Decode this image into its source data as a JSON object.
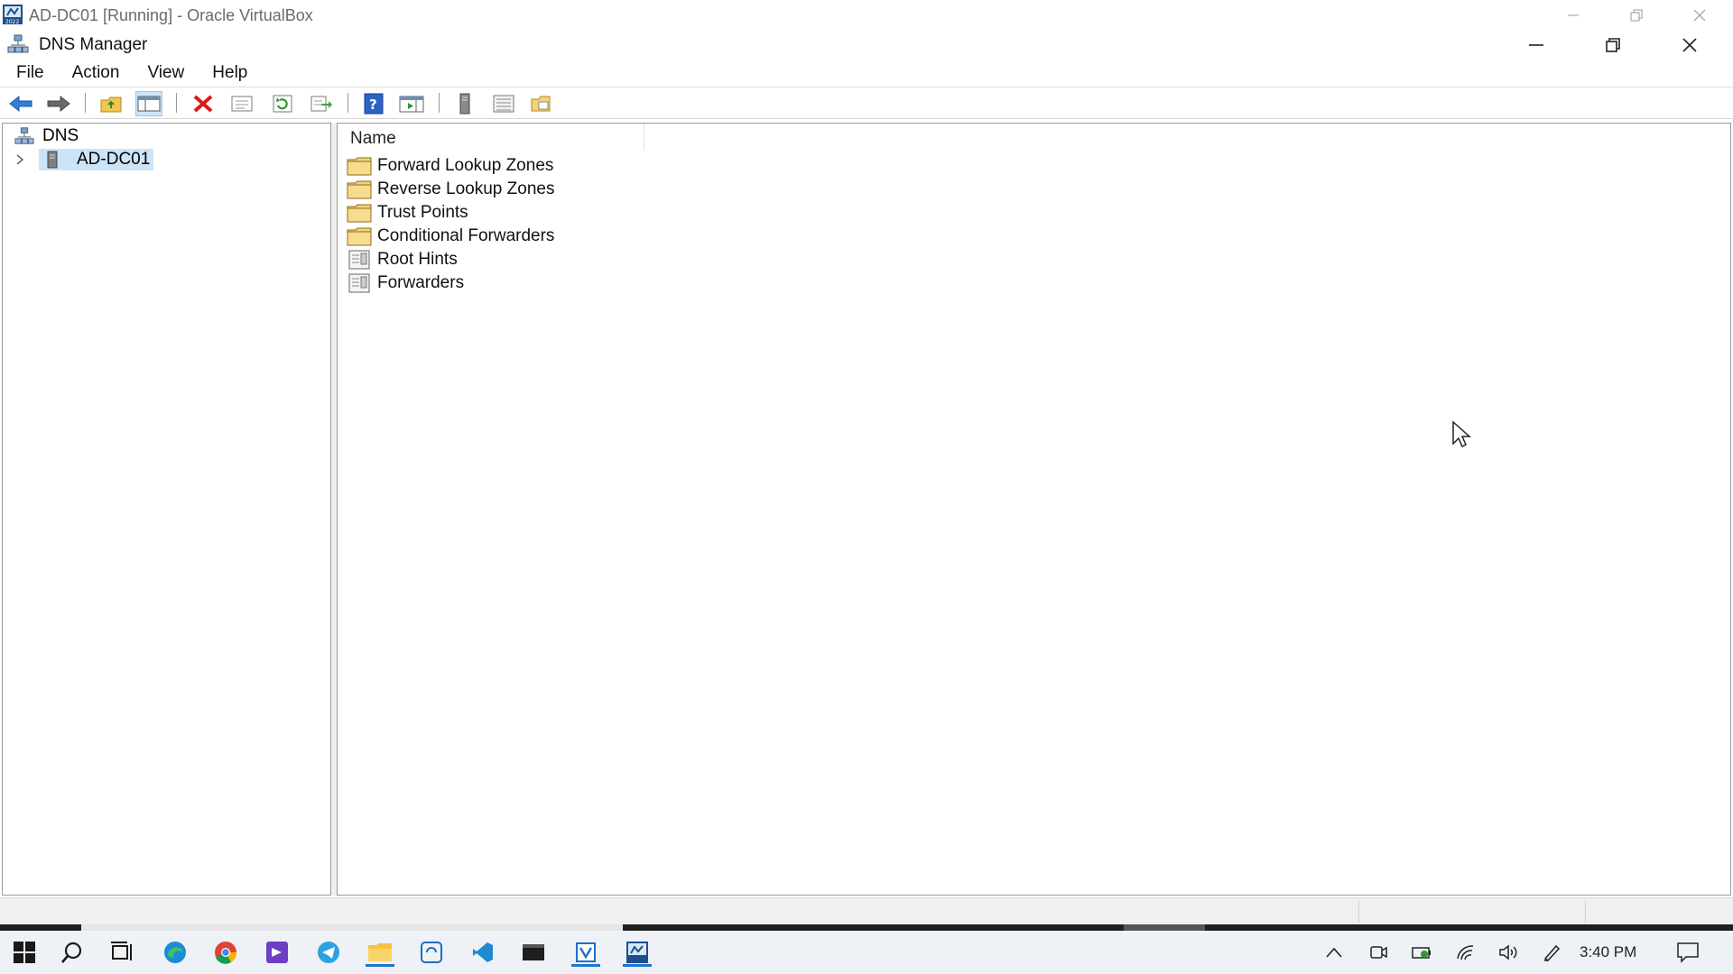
{
  "vbox": {
    "title": "AD-DC01 [Running] - Oracle VirtualBox"
  },
  "app": {
    "title": "DNS Manager"
  },
  "menu": {
    "items": [
      "File",
      "Action",
      "View",
      "Help"
    ]
  },
  "toolbar": {
    "buttons": [
      "back-arrow-icon",
      "forward-arrow-icon",
      "up-folder-icon",
      "show-hide-console-tree-icon",
      "delete-icon",
      "properties-icon",
      "refresh-icon",
      "export-list-icon",
      "help-icon",
      "show-action-pane-icon",
      "server-icon",
      "list-view-icon",
      "new-folder-icon"
    ]
  },
  "tree": {
    "root": "DNS",
    "server": "AD-DC01"
  },
  "list": {
    "column_header": "Name",
    "items": [
      {
        "label": "Forward Lookup Zones",
        "icon": "folder-icon"
      },
      {
        "label": "Reverse Lookup Zones",
        "icon": "folder-icon"
      },
      {
        "label": "Trust Points",
        "icon": "folder-icon"
      },
      {
        "label": "Conditional Forwarders",
        "icon": "folder-icon"
      },
      {
        "label": "Root Hints",
        "icon": "records-icon"
      },
      {
        "label": "Forwarders",
        "icon": "records-icon"
      }
    ]
  },
  "taskbar": {
    "clock": "3:40 PM",
    "apps": [
      "start-icon",
      "search-icon",
      "task-view-icon",
      "edge-icon",
      "chrome-icon",
      "visual-studio-icon",
      "telegram-icon",
      "file-explorer-icon",
      "remote-desktop-icon",
      "vscode-icon",
      "terminal-icon",
      "virtualbox-icon",
      "virtualbox-vm-icon"
    ]
  },
  "colors": {
    "selection": "#cce4f7",
    "accent": "#1f74d0",
    "folder": "#f3d27a"
  }
}
